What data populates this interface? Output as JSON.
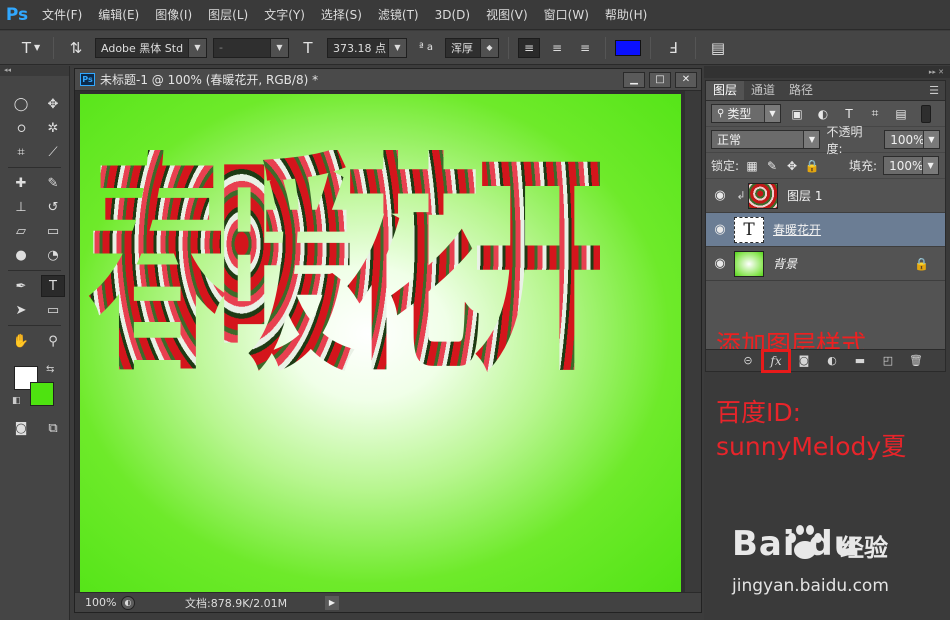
{
  "app": {
    "logo": "Ps"
  },
  "menu": [
    "文件(F)",
    "编辑(E)",
    "图像(I)",
    "图层(L)",
    "文字(Y)",
    "选择(S)",
    "滤镜(T)",
    "3D(D)",
    "视图(V)",
    "窗口(W)",
    "帮助(H)"
  ],
  "options": {
    "tool_glyph": "T",
    "font_family": "Adobe 黑体 Std",
    "font_style": "-",
    "font_size": "373.18 点",
    "aa_label": "ª a",
    "antialias": "浑厚",
    "text_color": "#0a10ff"
  },
  "document": {
    "title": "未标题-1 @ 100% (春暖花开, RGB/8) *",
    "canvas_text": "春暖花开",
    "zoom": "100%",
    "doc_info": "文档:878.9K/2.01M"
  },
  "colors": {
    "foreground": "#ffffff",
    "background": "#4ee310",
    "annotation": "#e8242a"
  },
  "layers_panel": {
    "tabs": [
      "图层",
      "通道",
      "路径"
    ],
    "filter_kind": "类型",
    "blend_mode": "正常",
    "opacity_label": "不透明度:",
    "opacity": "100%",
    "lock_label": "锁定:",
    "fill_label": "填充:",
    "fill": "100%",
    "layers": [
      {
        "name": "图层 1",
        "thumb": "flowers",
        "clipped": true,
        "selected": false,
        "locked": false
      },
      {
        "name": "春暖花开",
        "thumb": "text",
        "clipped": false,
        "selected": true,
        "locked": false
      },
      {
        "name": "背景",
        "thumb": "gradient",
        "clipped": false,
        "selected": false,
        "locked": true
      }
    ]
  },
  "annotations": {
    "fx_hint": "添加图层样式",
    "author_line1": "百度ID:",
    "author_line2": "sunnyMelody夏"
  },
  "watermark": {
    "logo_text": "Bai du",
    "jingyan": "经验",
    "url": "jingyan.baidu.com"
  }
}
